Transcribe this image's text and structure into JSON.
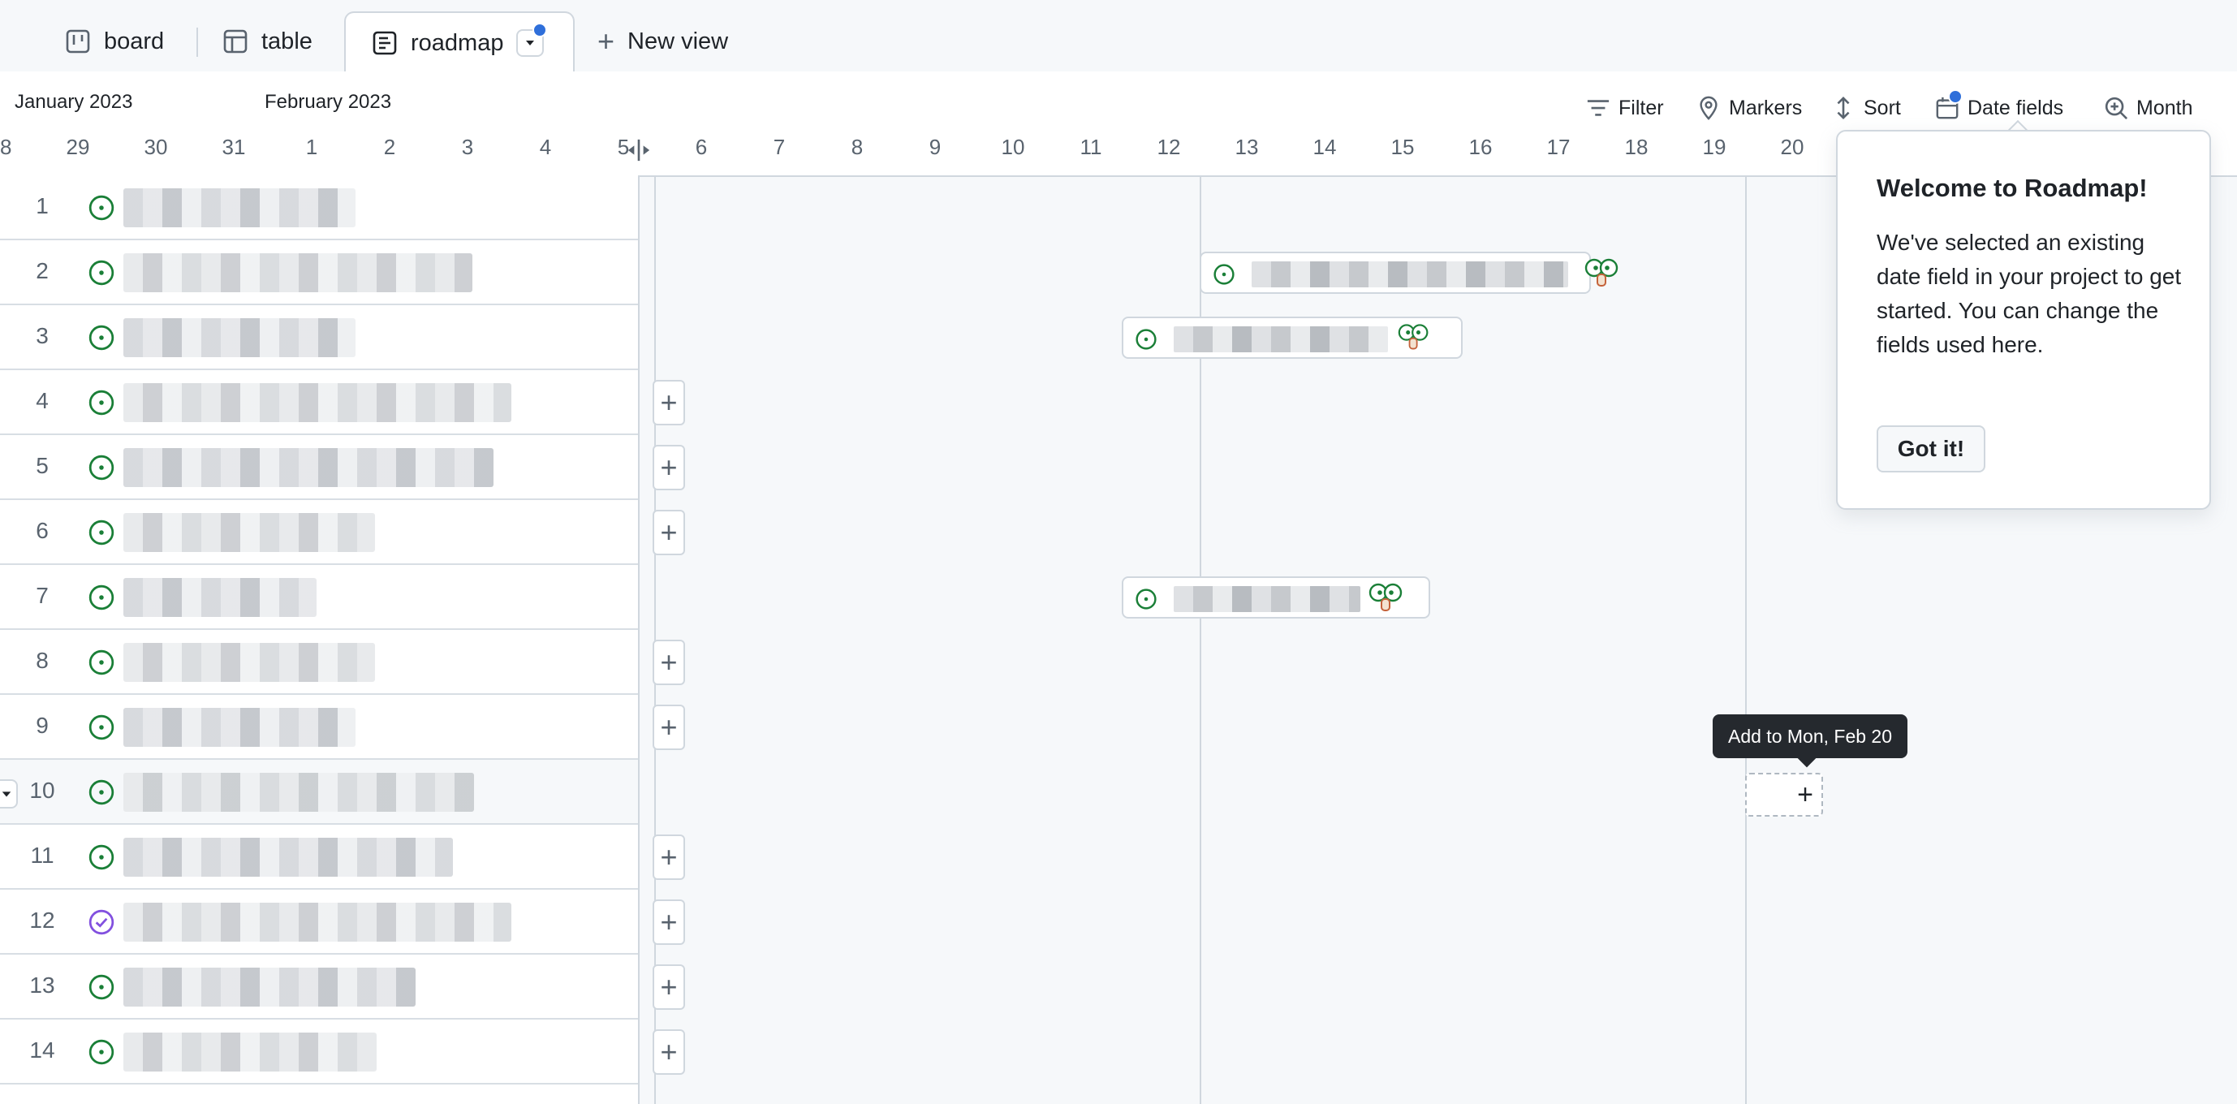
{
  "tabs": {
    "board": "board",
    "table": "table",
    "roadmap": "roadmap",
    "new_view": "New view"
  },
  "months": {
    "jan": "January 2023",
    "feb": "February 2023"
  },
  "days": [
    "28",
    "29",
    "30",
    "31",
    "1",
    "2",
    "3",
    "4",
    "5",
    "6",
    "7",
    "8",
    "9",
    "10",
    "11",
    "12",
    "13",
    "14",
    "15",
    "16",
    "17",
    "18",
    "19",
    "20"
  ],
  "toolbar": {
    "filter": "Filter",
    "markers": "Markers",
    "sort": "Sort",
    "date_fields": "Date fields",
    "zoom": "Month"
  },
  "rows": [
    {
      "num": "1",
      "status": "open"
    },
    {
      "num": "2",
      "status": "open"
    },
    {
      "num": "3",
      "status": "open"
    },
    {
      "num": "4",
      "status": "open"
    },
    {
      "num": "5",
      "status": "open"
    },
    {
      "num": "6",
      "status": "open"
    },
    {
      "num": "7",
      "status": "open"
    },
    {
      "num": "8",
      "status": "open"
    },
    {
      "num": "9",
      "status": "open"
    },
    {
      "num": "10",
      "status": "open"
    },
    {
      "num": "11",
      "status": "open"
    },
    {
      "num": "12",
      "status": "done"
    },
    {
      "num": "13",
      "status": "open"
    },
    {
      "num": "14",
      "status": "open"
    }
  ],
  "popover": {
    "title": "Welcome to Roadmap!",
    "body": "We've selected an existing date field in your project to get started. You can change the fields used here.",
    "button": "Got it!"
  },
  "tooltip": "Add to Mon, Feb 20",
  "colors": {
    "open": "#1a7f37",
    "done": "#8250df",
    "accent": "#2f6fda"
  }
}
